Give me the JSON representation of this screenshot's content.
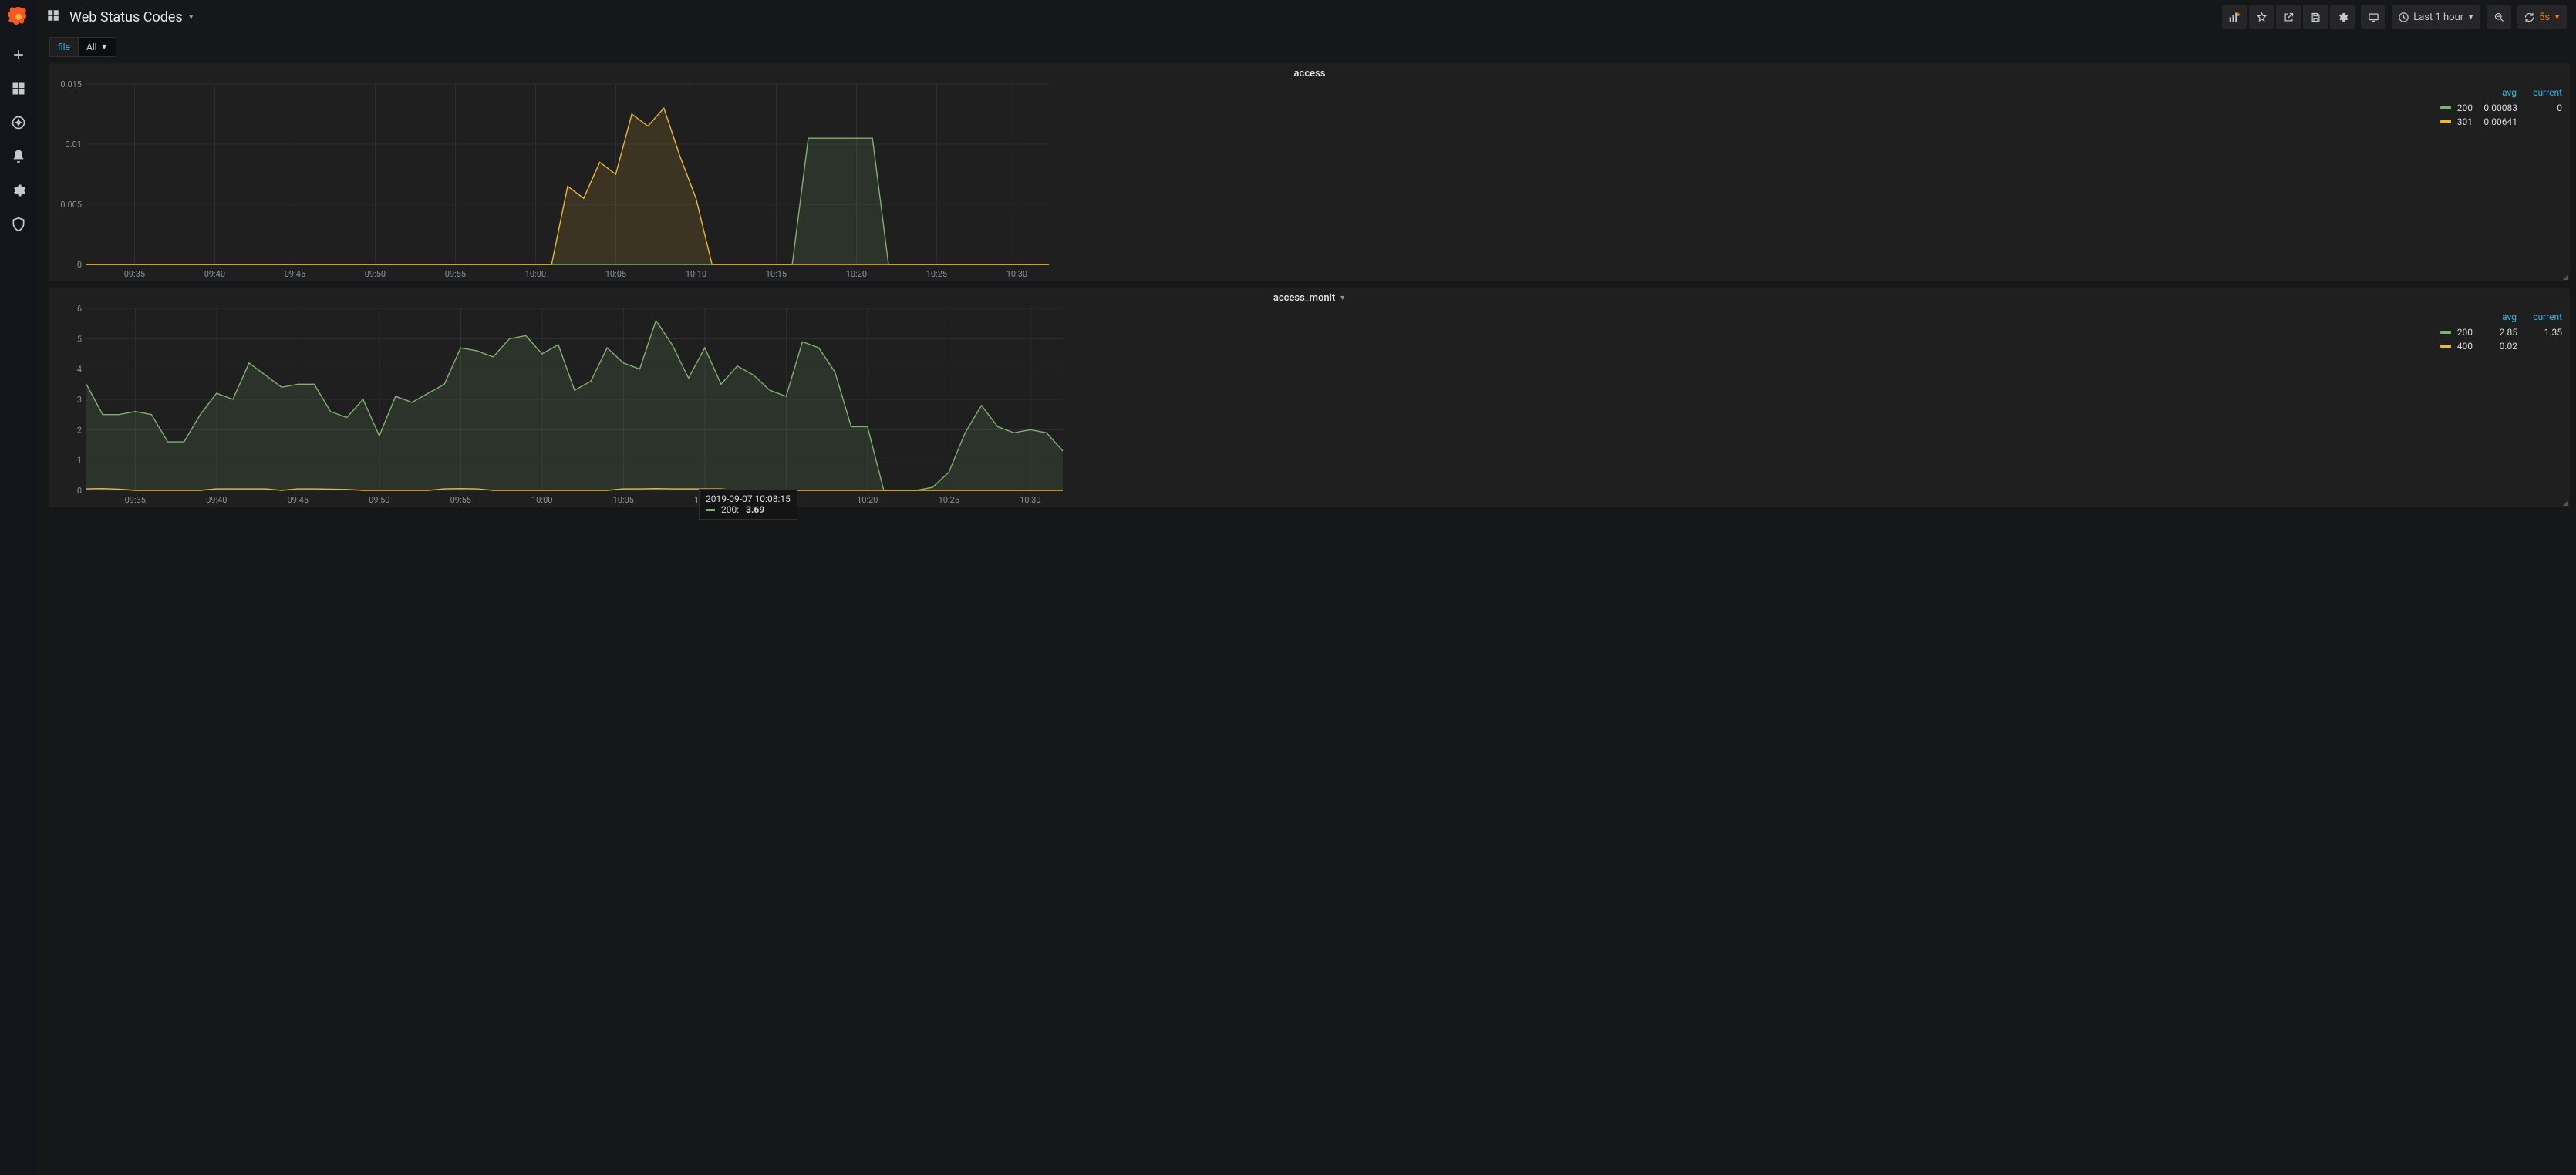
{
  "header": {
    "title": "Web Status Codes",
    "time_range": "Last 1 hour",
    "refresh_rate": "5s",
    "var_label": "file",
    "var_value": "All"
  },
  "panels": [
    {
      "title": "access",
      "legend_headers": [
        "avg",
        "current"
      ],
      "series": [
        {
          "name": "200",
          "color": "#7eb26d",
          "avg": "0.00083",
          "current": "0"
        },
        {
          "name": "301",
          "color": "#eab839",
          "avg": "0.00641",
          "current": ""
        }
      ]
    },
    {
      "title": "access_monit",
      "legend_headers": [
        "avg",
        "current"
      ],
      "series": [
        {
          "name": "200",
          "color": "#7eb26d",
          "avg": "2.85",
          "current": "1.35"
        },
        {
          "name": "400",
          "color": "#eab839",
          "avg": "0.02",
          "current": ""
        }
      ]
    }
  ],
  "tooltip": {
    "timestamp": "2019-09-07 10:08:15",
    "series": "200",
    "value": "3.69",
    "color": "#7eb26d"
  },
  "chart_data": [
    {
      "type": "line",
      "title": "access",
      "xlabel": "",
      "ylabel": "",
      "ylim": [
        0,
        0.015
      ],
      "x_ticks": [
        "09:35",
        "09:40",
        "09:45",
        "09:50",
        "09:55",
        "10:00",
        "10:05",
        "10:10",
        "10:15",
        "10:20",
        "10:25",
        "10:30"
      ],
      "x": [
        "09:32",
        "09:33",
        "09:34",
        "09:35",
        "09:36",
        "09:37",
        "09:38",
        "09:39",
        "09:40",
        "09:41",
        "09:42",
        "09:43",
        "09:44",
        "09:45",
        "09:46",
        "09:47",
        "09:48",
        "09:49",
        "09:50",
        "09:51",
        "09:52",
        "09:53",
        "09:54",
        "09:55",
        "09:56",
        "09:57",
        "09:58",
        "09:59",
        "10:00",
        "10:01",
        "10:02",
        "10:03",
        "10:04",
        "10:05",
        "10:06",
        "10:07",
        "10:08",
        "10:09",
        "10:10",
        "10:11",
        "10:12",
        "10:13",
        "10:14",
        "10:15",
        "10:16",
        "10:17",
        "10:18",
        "10:19",
        "10:20",
        "10:21",
        "10:22",
        "10:23",
        "10:24",
        "10:25",
        "10:26",
        "10:27",
        "10:28",
        "10:29",
        "10:30",
        "10:31",
        "10:32"
      ],
      "series": [
        {
          "name": "200",
          "color": "#7eb26d",
          "values": [
            0,
            0,
            0,
            0,
            0,
            0,
            0,
            0,
            0,
            0,
            0,
            0,
            0,
            0,
            0,
            0,
            0,
            0,
            0,
            0,
            0,
            0,
            0,
            0,
            0,
            0,
            0,
            0,
            0,
            0,
            0,
            0,
            0,
            0,
            0,
            0,
            0,
            0,
            0,
            0,
            0,
            0,
            0,
            0,
            0,
            0.0105,
            0.0105,
            0.0105,
            0.0105,
            0.0105,
            0,
            0,
            0,
            0,
            0,
            0,
            0,
            0,
            0,
            0,
            0
          ]
        },
        {
          "name": "301",
          "color": "#eab839",
          "values": [
            0,
            0,
            0,
            0,
            0,
            0,
            0,
            0,
            0,
            0,
            0,
            0,
            0,
            0,
            0,
            0,
            0,
            0,
            0,
            0,
            0,
            0,
            0,
            0,
            0,
            0,
            0,
            0,
            0,
            0,
            0.0065,
            0.0055,
            0.0085,
            0.0075,
            0.0125,
            0.0115,
            0.013,
            0.009,
            0.0055,
            0,
            0,
            0,
            0,
            0,
            0,
            0,
            0,
            0,
            0,
            0,
            0,
            0,
            0,
            0,
            0,
            0,
            0,
            0,
            0,
            0,
            0
          ]
        }
      ]
    },
    {
      "type": "line",
      "title": "access_monit",
      "xlabel": "",
      "ylabel": "",
      "ylim": [
        0,
        6
      ],
      "x_ticks": [
        "09:35",
        "09:40",
        "09:45",
        "09:50",
        "09:55",
        "10:00",
        "10:05",
        "10:10",
        "10:15",
        "10:20",
        "10:25",
        "10:30"
      ],
      "x": [
        "09:32",
        "09:33",
        "09:34",
        "09:35",
        "09:36",
        "09:37",
        "09:38",
        "09:39",
        "09:40",
        "09:41",
        "09:42",
        "09:43",
        "09:44",
        "09:45",
        "09:46",
        "09:47",
        "09:48",
        "09:49",
        "09:50",
        "09:51",
        "09:52",
        "09:53",
        "09:54",
        "09:55",
        "09:56",
        "09:57",
        "09:58",
        "09:59",
        "10:00",
        "10:01",
        "10:02",
        "10:03",
        "10:04",
        "10:05",
        "10:06",
        "10:07",
        "10:08",
        "10:09",
        "10:10",
        "10:11",
        "10:12",
        "10:13",
        "10:14",
        "10:15",
        "10:16",
        "10:17",
        "10:18",
        "10:19",
        "10:20",
        "10:21",
        "10:22",
        "10:23",
        "10:24",
        "10:25",
        "10:26",
        "10:27",
        "10:28",
        "10:29",
        "10:30",
        "10:31",
        "10:32"
      ],
      "series": [
        {
          "name": "200",
          "color": "#7eb26d",
          "values": [
            3.5,
            2.5,
            2.5,
            2.6,
            2.5,
            1.6,
            1.6,
            2.5,
            3.2,
            3.0,
            4.2,
            3.8,
            3.4,
            3.5,
            3.5,
            2.6,
            2.4,
            3.0,
            1.8,
            3.1,
            2.9,
            3.2,
            3.5,
            4.7,
            4.6,
            4.4,
            5.0,
            5.1,
            4.5,
            4.8,
            3.3,
            3.6,
            4.7,
            4.2,
            4.0,
            5.6,
            4.8,
            3.7,
            4.7,
            3.5,
            4.1,
            3.8,
            3.3,
            3.1,
            4.9,
            4.7,
            3.9,
            2.1,
            2.1,
            0,
            0,
            0,
            0.1,
            0.6,
            1.9,
            2.8,
            2.1,
            1.9,
            2.0,
            1.9,
            1.3
          ]
        },
        {
          "name": "400",
          "color": "#eab839",
          "values": [
            0.05,
            0.06,
            0.04,
            0,
            0,
            0,
            0,
            0,
            0.05,
            0.05,
            0.05,
            0.05,
            0,
            0.05,
            0.05,
            0.04,
            0.03,
            0,
            0,
            0,
            0,
            0,
            0.05,
            0.06,
            0.05,
            0,
            0,
            0,
            0,
            0,
            0,
            0,
            0,
            0.05,
            0.05,
            0.06,
            0.05,
            0.05,
            0.05,
            0.05,
            0,
            0,
            0,
            0,
            0,
            0,
            0,
            0,
            0,
            0,
            0,
            0,
            0,
            0,
            0,
            0,
            0,
            0,
            0,
            0,
            0
          ]
        }
      ]
    }
  ]
}
